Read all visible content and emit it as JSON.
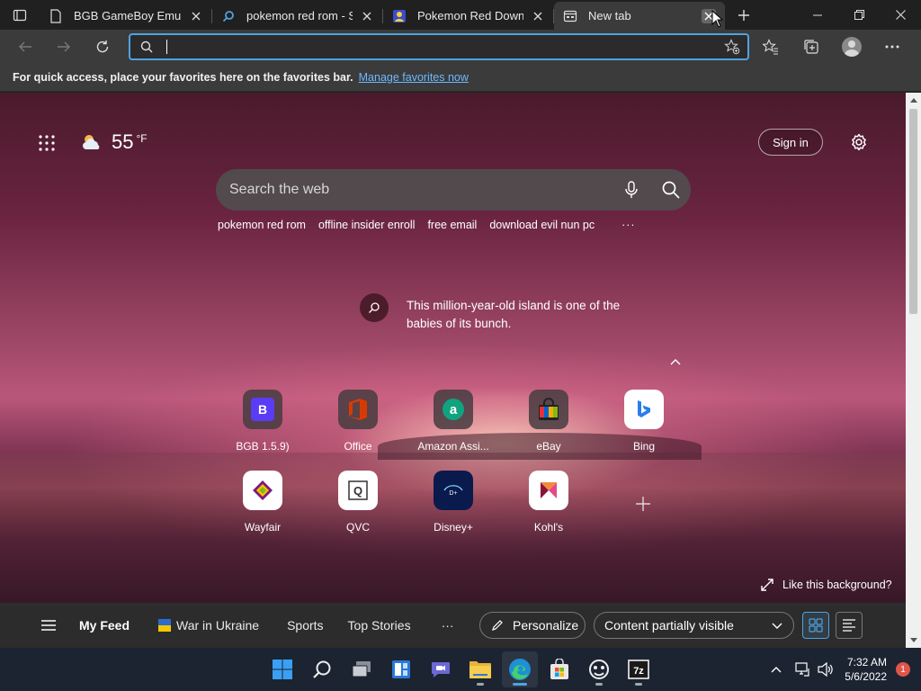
{
  "browser": {
    "tabs": [
      {
        "title": "BGB GameBoy Emulator",
        "favicon": "page-icon"
      },
      {
        "title": "pokemon red rom - Search",
        "favicon": "search-icon"
      },
      {
        "title": "Pokemon Red Download",
        "favicon": "site-icon"
      },
      {
        "title": "New tab",
        "favicon": "newtab-icon",
        "active": true
      }
    ],
    "address": {
      "value": "",
      "placeholder": ""
    },
    "favorites_bar": {
      "message": "For quick access, place your favorites here on the favorites bar.",
      "link": "Manage favorites now"
    }
  },
  "newtab": {
    "weather": {
      "temp": "55",
      "unit": "°F",
      "icon": "partly-cloudy-icon"
    },
    "signin_label": "Sign in",
    "search_placeholder": "Search the web",
    "suggestions": [
      "pokemon red rom",
      "offline insider enroll",
      "free email",
      "download evil nun pc"
    ],
    "suggestions_more": "···",
    "story": "This million-year-old island is one of the babies of its bunch.",
    "quick_links": [
      {
        "label": "BGB 1.5.9)",
        "icon": "bgb-icon",
        "color": "#5b3cf5"
      },
      {
        "label": "Office",
        "icon": "office-icon",
        "color": "#d83b01"
      },
      {
        "label": "Amazon Assi...",
        "icon": "amazon-assistant-icon",
        "color": "#10a37f"
      },
      {
        "label": "eBay",
        "icon": "ebay-icon",
        "color": "#e53238"
      },
      {
        "label": "Bing",
        "icon": "bing-icon",
        "color": "#2b7de9"
      },
      {
        "label": "Wayfair",
        "icon": "wayfair-icon",
        "color": "#7f187f"
      },
      {
        "label": "QVC",
        "icon": "qvc-icon",
        "color": "#333333"
      },
      {
        "label": "Disney+",
        "icon": "disney-plus-icon",
        "color": "#0a1a4d"
      },
      {
        "label": "Kohl's",
        "icon": "kohls-icon",
        "color": "#8a1538"
      }
    ],
    "like_background": "Like this background?",
    "feed": {
      "my_feed": "My Feed",
      "items": [
        "War in Ukraine",
        "Sports",
        "Top Stories"
      ],
      "more": "···",
      "personalize": "Personalize",
      "visibility": "Content partially visible"
    }
  },
  "taskbar": {
    "time": "7:32 AM",
    "date": "5/6/2022",
    "notifications": "1"
  }
}
